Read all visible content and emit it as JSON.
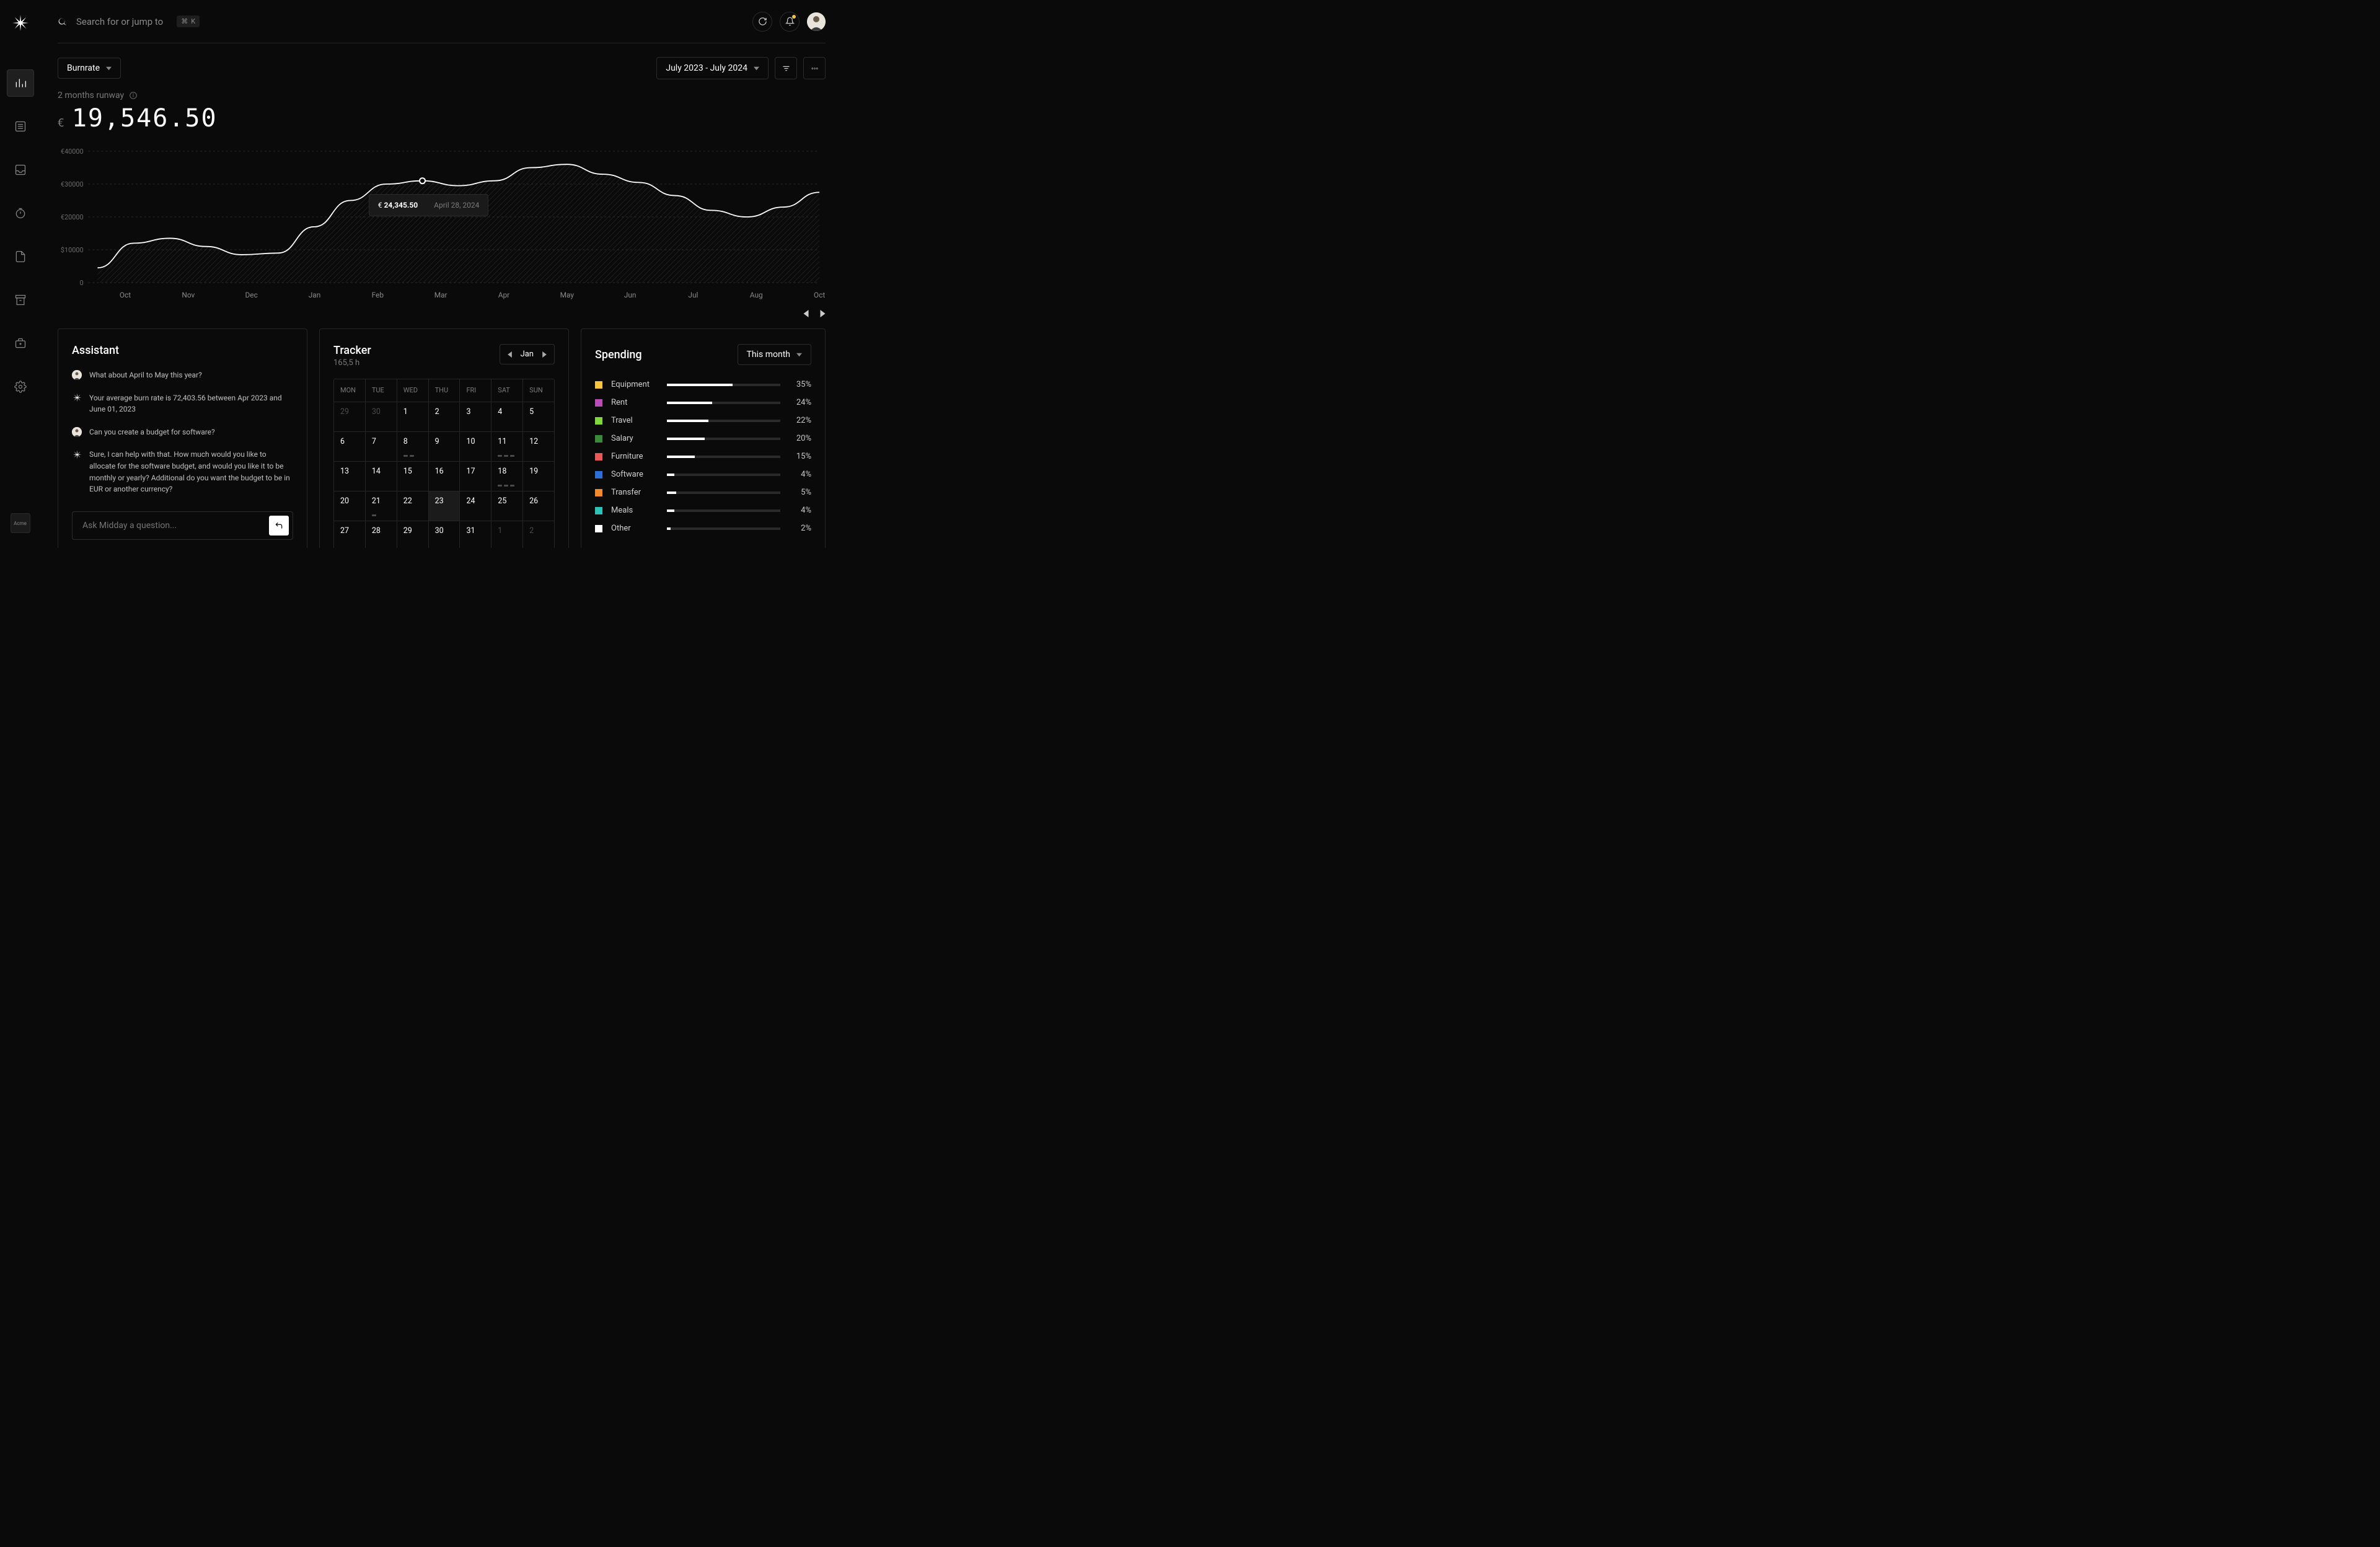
{
  "company_badge": "Acme",
  "search": {
    "placeholder": "Search for or jump to",
    "shortcut_mod": "⌘",
    "shortcut_key": "K"
  },
  "filters": {
    "metric": "Burnrate",
    "date_range": "July 2023 - July 2024"
  },
  "runway": {
    "label": "2 months runway",
    "currency": "€",
    "amount": "19,546.50"
  },
  "chart_tooltip": {
    "currency": "€",
    "value": "24,345.50",
    "date": "April 28, 2024"
  },
  "chart_data": {
    "type": "area",
    "title": "Burnrate",
    "xlabel": "",
    "ylabel": "",
    "ylim": [
      0,
      40000
    ],
    "y_ticks": [
      "€40000",
      "€30000",
      "€20000",
      "$10000",
      "0"
    ],
    "x_ticks": [
      "Oct",
      "Nov",
      "Dec",
      "Jan",
      "Feb",
      "Mar",
      "Apr",
      "May",
      "Jun",
      "Jul",
      "Aug",
      "Oct"
    ],
    "values": [
      4500,
      12000,
      13500,
      11000,
      8500,
      9000,
      17000,
      25000,
      30000,
      31000,
      29500,
      31000,
      35000,
      36000,
      33000,
      30500,
      26500,
      22000,
      20000,
      23000,
      27500
    ]
  },
  "assistant": {
    "title": "Assistant",
    "messages": [
      {
        "role": "user",
        "text": "What about April to May this year?"
      },
      {
        "role": "ai",
        "text": "Your average burn rate is 72,403.56 between Apr 2023 and June 01, 2023"
      },
      {
        "role": "user",
        "text": "Can you create a budget for software?"
      },
      {
        "role": "ai",
        "text": "Sure, I can help with that. How much would you like to allocate for the software budget, and would you like it to be monthly or yearly? Additional do you want the budget to be in EUR or another currency?"
      }
    ],
    "input_placeholder": "Ask Midday a question..."
  },
  "tracker": {
    "title": "Tracker",
    "subtitle": "165,5 h",
    "month": "Jan",
    "weekdays": [
      "MON",
      "TUE",
      "WED",
      "THU",
      "FRI",
      "SAT",
      "SUN"
    ],
    "weeks": [
      [
        {
          "d": "29",
          "dim": true
        },
        {
          "d": "30",
          "dim": true
        },
        {
          "d": "1"
        },
        {
          "d": "2"
        },
        {
          "d": "3"
        },
        {
          "d": "4"
        },
        {
          "d": "5"
        }
      ],
      [
        {
          "d": "6"
        },
        {
          "d": "7"
        },
        {
          "d": "8",
          "dots": 2
        },
        {
          "d": "9"
        },
        {
          "d": "10"
        },
        {
          "d": "11",
          "dots": 3
        },
        {
          "d": "12"
        }
      ],
      [
        {
          "d": "13"
        },
        {
          "d": "14"
        },
        {
          "d": "15"
        },
        {
          "d": "16"
        },
        {
          "d": "17"
        },
        {
          "d": "18",
          "dots": 3
        },
        {
          "d": "19"
        }
      ],
      [
        {
          "d": "20"
        },
        {
          "d": "21",
          "dots": 1
        },
        {
          "d": "22"
        },
        {
          "d": "23",
          "today": true
        },
        {
          "d": "24"
        },
        {
          "d": "25"
        },
        {
          "d": "26"
        }
      ],
      [
        {
          "d": "27"
        },
        {
          "d": "28"
        },
        {
          "d": "29"
        },
        {
          "d": "30"
        },
        {
          "d": "31"
        },
        {
          "d": "1",
          "dim": true
        },
        {
          "d": "2",
          "dim": true
        }
      ]
    ]
  },
  "spending": {
    "title": "Spending",
    "range": "This month",
    "items": [
      {
        "label": "Equipment",
        "pct": 35,
        "color": "#f5c542"
      },
      {
        "label": "Rent",
        "pct": 24,
        "color": "#b84db8"
      },
      {
        "label": "Travel",
        "pct": 22,
        "color": "#7fd63f"
      },
      {
        "label": "Salary",
        "pct": 20,
        "color": "#3a8a3a"
      },
      {
        "label": "Furniture",
        "pct": 15,
        "color": "#e85a5a"
      },
      {
        "label": "Software",
        "pct": 4,
        "color": "#2c6fd6"
      },
      {
        "label": "Transfer",
        "pct": 5,
        "color": "#f08a2c"
      },
      {
        "label": "Meals",
        "pct": 4,
        "color": "#2cc4b8"
      },
      {
        "label": "Other",
        "pct": 2,
        "color": "#ffffff"
      }
    ]
  }
}
